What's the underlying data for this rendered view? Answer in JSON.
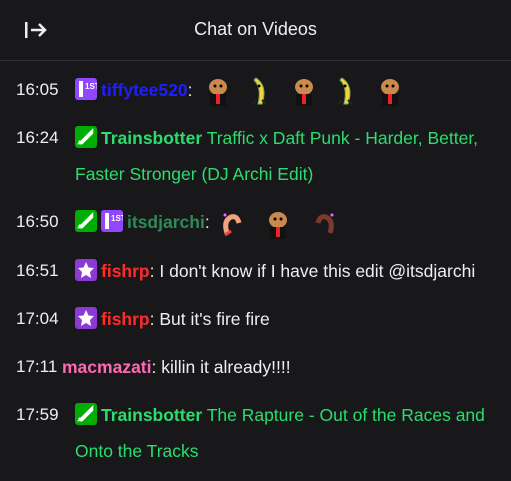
{
  "header": {
    "title": "Chat on Videos"
  },
  "colors": {
    "background": "#18181b",
    "text": "#efeff1",
    "mod_badge": "#00ad03",
    "sub_badge": "#9146ff",
    "green_user": "#2bdd6d",
    "blue_user": "#1e1eff",
    "red_user": "#ff2b2b",
    "teal_user": "#2e8b57",
    "pink_user": "#ff69b4"
  },
  "messages": [
    {
      "time": "16:05",
      "user": "tiffytee520",
      "text": "",
      "badges": [
        "sub-1st"
      ],
      "emotes": [
        "dog-emote",
        "banana-emote",
        "dog-emote",
        "banana-emote",
        "dog-emote"
      ]
    },
    {
      "time": "16:24",
      "user": "Trainsbotter",
      "text": "Traffic x Daft Punk - Harder, Better, Faster Stronger (DJ Archi Edit)",
      "badges": [
        "moderator"
      ]
    },
    {
      "time": "16:50",
      "user": "itsdjarchi",
      "text": "",
      "badges": [
        "moderator",
        "sub-1st"
      ],
      "emotes": [
        "heart-hand-left-emote",
        "dog-emote",
        "heart-hand-right-emote"
      ]
    },
    {
      "time": "16:51",
      "user": "fishrp",
      "text": "I don't know if I have this edit @itsdjarchi",
      "badges": [
        "star"
      ]
    },
    {
      "time": "17:04",
      "user": "fishrp",
      "text": "But it's fire fire",
      "badges": [
        "star"
      ]
    },
    {
      "time": "17:11",
      "user": "macmazati",
      "text": "killin it already!!!!",
      "badges": []
    },
    {
      "time": "17:59",
      "user": "Trainsbotter",
      "text": "The Rapture - Out of the Races and Onto the Tracks",
      "badges": [
        "moderator"
      ]
    }
  ]
}
